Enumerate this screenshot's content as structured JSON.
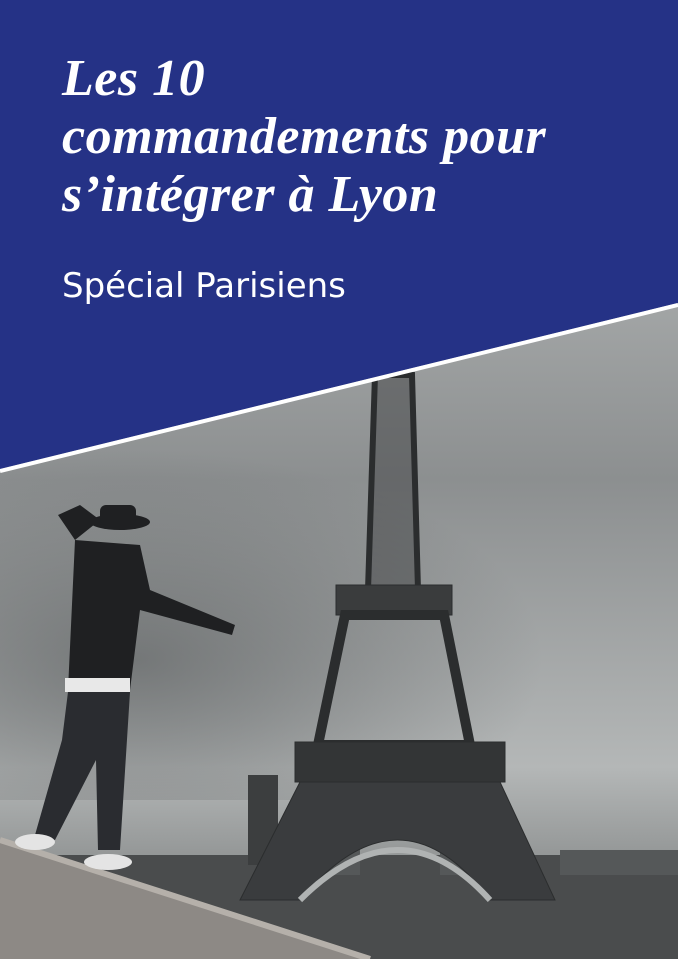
{
  "cover": {
    "title_lines": [
      "Les 10",
      "commandements pour",
      "s’intégrer à Lyon"
    ],
    "subtitle": "Spécial Parisiens",
    "colors": {
      "band": "#253286",
      "divider": "#ffffff",
      "text": "#ffffff"
    },
    "photo_subject": "man on wall pointing at Eiffel Tower, black and white"
  }
}
